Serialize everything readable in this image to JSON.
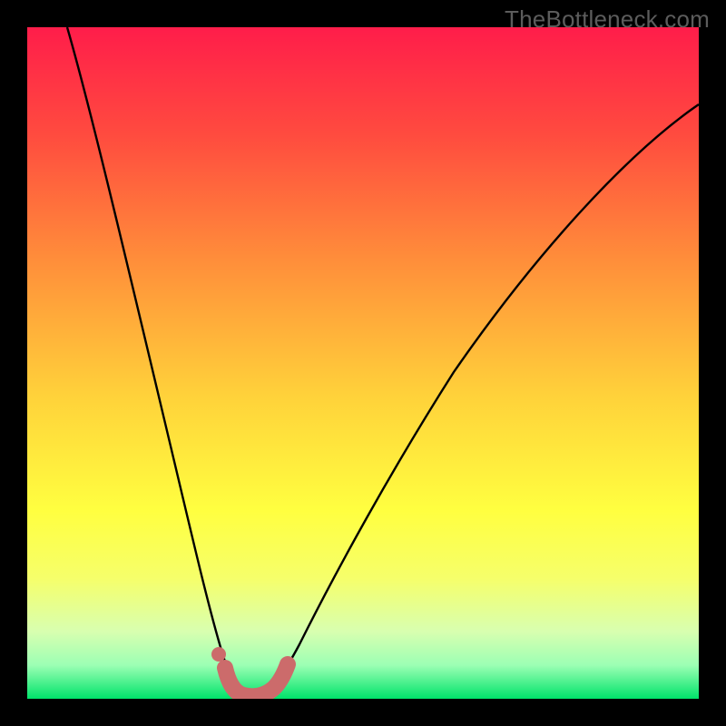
{
  "watermark": "TheBottleneck.com",
  "chart_data": {
    "type": "line",
    "title": "",
    "xlabel": "",
    "ylabel": "",
    "xlim": [
      0,
      100
    ],
    "ylim": [
      0,
      100
    ],
    "grid": false,
    "notes": "Bottleneck V-curve over a red-to-green vertical heat gradient. X axis is component balance position (arbitrary 0–100). Y axis is bottleneck magnitude (arbitrary 0–100, 0 at green band). Curve minimum marks the balanced/no-bottleneck point. Salmon overlay marks the recommended range around the minimum.",
    "background_gradient_stops": [
      {
        "pos": 0.0,
        "color": "#ff1d4a"
      },
      {
        "pos": 0.16,
        "color": "#ff4b3f"
      },
      {
        "pos": 0.35,
        "color": "#ff8f3a"
      },
      {
        "pos": 0.55,
        "color": "#ffd23a"
      },
      {
        "pos": 0.72,
        "color": "#ffff40"
      },
      {
        "pos": 0.82,
        "color": "#f6ff6a"
      },
      {
        "pos": 0.9,
        "color": "#d8ffb0"
      },
      {
        "pos": 0.95,
        "color": "#9cffb4"
      },
      {
        "pos": 1.0,
        "color": "#00e36a"
      }
    ],
    "series": [
      {
        "name": "bottleneck-curve",
        "color": "#000000",
        "x": [
          6,
          8,
          10,
          12,
          14,
          16,
          18,
          20,
          22,
          24,
          26,
          27,
          28,
          29,
          30,
          31,
          32,
          33,
          34,
          35,
          37,
          40,
          44,
          50,
          56,
          62,
          70,
          78,
          86,
          94,
          100
        ],
        "y": [
          100,
          92,
          84,
          76,
          68,
          60,
          52,
          44,
          36,
          28,
          20,
          15,
          11,
          7,
          4,
          2,
          1,
          1,
          2,
          3,
          6,
          11,
          18,
          28,
          37,
          45,
          54,
          62,
          69,
          74,
          78
        ]
      }
    ],
    "annotations": [
      {
        "name": "optimal-range-highlight",
        "color": "#cc6b6b",
        "shape": "thick-u",
        "x_range": [
          28,
          36
        ],
        "y": 1
      }
    ]
  }
}
